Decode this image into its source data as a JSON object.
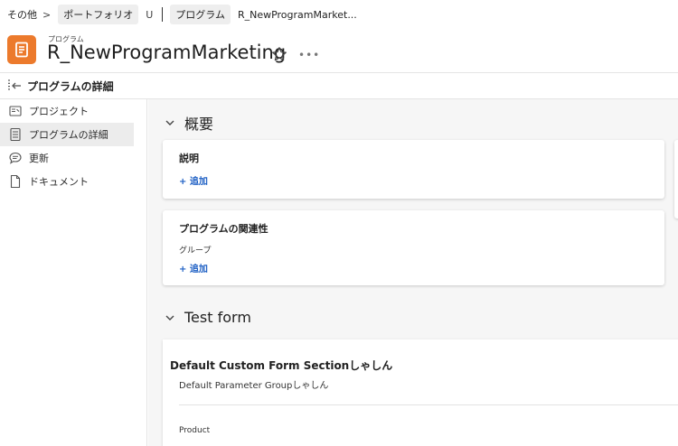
{
  "breadcrumb": {
    "more": "その他",
    "sep": ">",
    "portfolio": "ポートフォリオ",
    "portfolio_suffix": "U",
    "program": "プログラム",
    "current": "R_NewProgramMarket..."
  },
  "header": {
    "kind": "プログラム",
    "title": "R_NewProgramMarketing",
    "more_glyph": "•••",
    "icon": "document-icon",
    "accent_color": "#ec7a2c"
  },
  "subheader": {
    "title": "プログラムの詳細"
  },
  "sidebar": {
    "items": [
      {
        "label": "プロジェクト",
        "icon": "project-icon",
        "active": false
      },
      {
        "label": "プログラムの詳細",
        "icon": "details-icon",
        "active": true
      },
      {
        "label": "更新",
        "icon": "comment-icon",
        "active": false
      },
      {
        "label": "ドキュメント",
        "icon": "file-icon",
        "active": false
      }
    ]
  },
  "main": {
    "overview": {
      "title": "概要",
      "description_card": {
        "title": "説明",
        "add": "+ 追加"
      },
      "relation_card": {
        "title": "プログラムの関連性",
        "group_label": "グループ",
        "add": "+ 追加"
      }
    },
    "test_form": {
      "title": "Test form",
      "section_title": "Default Custom Form Sectionしゃしん",
      "group_title": "Default Parameter Groupしゃしん",
      "field_label": "Product"
    }
  },
  "colors": {
    "link": "#1d5fc4",
    "content_bg": "#f6f6f6"
  }
}
